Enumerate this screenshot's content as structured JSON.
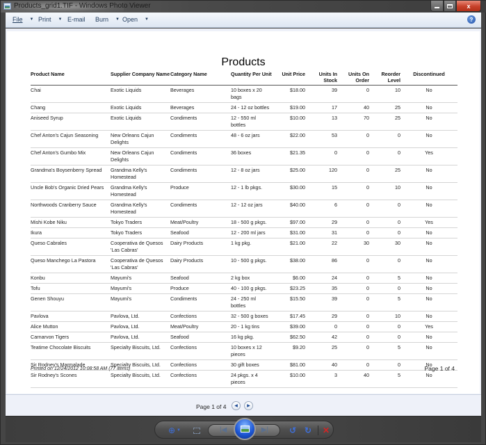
{
  "window": {
    "title": "Products_grid1.TIF - Windows Photo Viewer",
    "icons": {
      "app": "photo-viewer-icon",
      "minimize": "minimize-icon",
      "maximize": "maximize-icon",
      "close": "close-icon"
    },
    "close_glyph": "x"
  },
  "menubar": {
    "items": [
      {
        "label": "File",
        "has_dropdown": true
      },
      {
        "label": "Print",
        "has_dropdown": true
      },
      {
        "label": "E-mail",
        "has_dropdown": false
      },
      {
        "label": "Burn",
        "has_dropdown": true
      },
      {
        "label": "Open",
        "has_dropdown": true
      }
    ],
    "caret_glyph": "▼",
    "help_glyph": "?"
  },
  "document": {
    "title": "Products",
    "columns": [
      "Product Name",
      "Supplier Company Name",
      "Category Name",
      "Quantity Per Unit",
      "Unit Price",
      "Units In Stock",
      "Units On Order",
      "Reorder Level",
      "Discontinued"
    ],
    "rows": [
      [
        "Chai",
        "Exotic Liquids",
        "Beverages",
        "10 boxes x 20 bags",
        "$18.00",
        "39",
        "0",
        "10",
        "No"
      ],
      [
        "Chang",
        "Exotic Liquids",
        "Beverages",
        "24 - 12 oz bottles",
        "$19.00",
        "17",
        "40",
        "25",
        "No"
      ],
      [
        "Aniseed Syrup",
        "Exotic Liquids",
        "Condiments",
        "12 - 550 ml bottles",
        "$10.00",
        "13",
        "70",
        "25",
        "No"
      ],
      [
        "Chef Anton's Cajun Seasoning",
        "New Orleans Cajun Delights",
        "Condiments",
        "48 - 6 oz jars",
        "$22.00",
        "53",
        "0",
        "0",
        "No"
      ],
      [
        "Chef Anton's Gumbo Mix",
        "New Orleans Cajun Delights",
        "Condiments",
        "36 boxes",
        "$21.35",
        "0",
        "0",
        "0",
        "Yes"
      ],
      [
        "Grandma's Boysenberry Spread",
        "Grandma Kelly's Homestead",
        "Condiments",
        "12 - 8 oz jars",
        "$25.00",
        "120",
        "0",
        "25",
        "No"
      ],
      [
        "Uncle Bob's Organic Dried Pears",
        "Grandma Kelly's Homestead",
        "Produce",
        "12 - 1 lb pkgs.",
        "$30.00",
        "15",
        "0",
        "10",
        "No"
      ],
      [
        "Northwoods Cranberry Sauce",
        "Grandma Kelly's Homestead",
        "Condiments",
        "12 - 12 oz jars",
        "$40.00",
        "6",
        "0",
        "0",
        "No"
      ],
      [
        "Mishi Kobe Niku",
        "Tokyo Traders",
        "Meat/Poultry",
        "18 - 500 g pkgs.",
        "$97.00",
        "29",
        "0",
        "0",
        "Yes"
      ],
      [
        "Ikura",
        "Tokyo Traders",
        "Seafood",
        "12 - 200 ml jars",
        "$31.00",
        "31",
        "0",
        "0",
        "No"
      ],
      [
        "Queso Cabrales",
        "Cooperativa de Quesos 'Las Cabras'",
        "Dairy Products",
        "1 kg pkg.",
        "$21.00",
        "22",
        "30",
        "30",
        "No"
      ],
      [
        "Queso Manchego La Pastora",
        "Cooperativa de Quesos 'Las Cabras'",
        "Dairy Products",
        "10 - 500 g pkgs.",
        "$38.00",
        "86",
        "0",
        "0",
        "No"
      ],
      [
        "Konbu",
        "Mayumi's",
        "Seafood",
        "2 kg box",
        "$6.00",
        "24",
        "0",
        "5",
        "No"
      ],
      [
        "Tofu",
        "Mayumi's",
        "Produce",
        "40 - 100 g pkgs.",
        "$23.25",
        "35",
        "0",
        "0",
        "No"
      ],
      [
        "Genen Shouyu",
        "Mayumi's",
        "Condiments",
        "24 - 250 ml bottles",
        "$15.50",
        "39",
        "0",
        "5",
        "No"
      ],
      [
        "Pavlova",
        "Pavlova, Ltd.",
        "Confections",
        "32 - 500 g boxes",
        "$17.45",
        "29",
        "0",
        "10",
        "No"
      ],
      [
        "Alice Mutton",
        "Pavlova, Ltd.",
        "Meat/Poultry",
        "20 - 1 kg tins",
        "$39.00",
        "0",
        "0",
        "0",
        "Yes"
      ],
      [
        "Carnarvon Tigers",
        "Pavlova, Ltd.",
        "Seafood",
        "16 kg pkg.",
        "$62.50",
        "42",
        "0",
        "0",
        "No"
      ],
      [
        "Teatime Chocolate Biscuits",
        "Specialty Biscuits, Ltd.",
        "Confections",
        "10 boxes x 12 pieces",
        "$9.20",
        "25",
        "0",
        "5",
        "No"
      ],
      [
        "Sir Rodney's Marmalade",
        "Specialty Biscuits, Ltd.",
        "Confections",
        "30 gift boxes",
        "$81.00",
        "40",
        "0",
        "0",
        "No"
      ],
      [
        "Sir Rodney's Scones",
        "Specialty Biscuits, Ltd.",
        "Confections",
        "24 pkgs. x 4 pieces",
        "$10.00",
        "3",
        "40",
        "5",
        "No"
      ]
    ],
    "footer_printed": "Printed on 12/24/2012 10:08:58 AM (77 items)",
    "footer_page": "Page 1 of 4"
  },
  "page_nav": {
    "label": "Page 1 of 4",
    "prev_glyph": "◀",
    "next_glyph": "▶"
  },
  "toolbar": {
    "zoom_glyph": "⊕",
    "zoom_caret": "▼",
    "prev_glyph": "|◀",
    "next_glyph": "▶|",
    "rotate_ccw_glyph": "↺",
    "rotate_cw_glyph": "↻",
    "delete_glyph": "✕"
  }
}
